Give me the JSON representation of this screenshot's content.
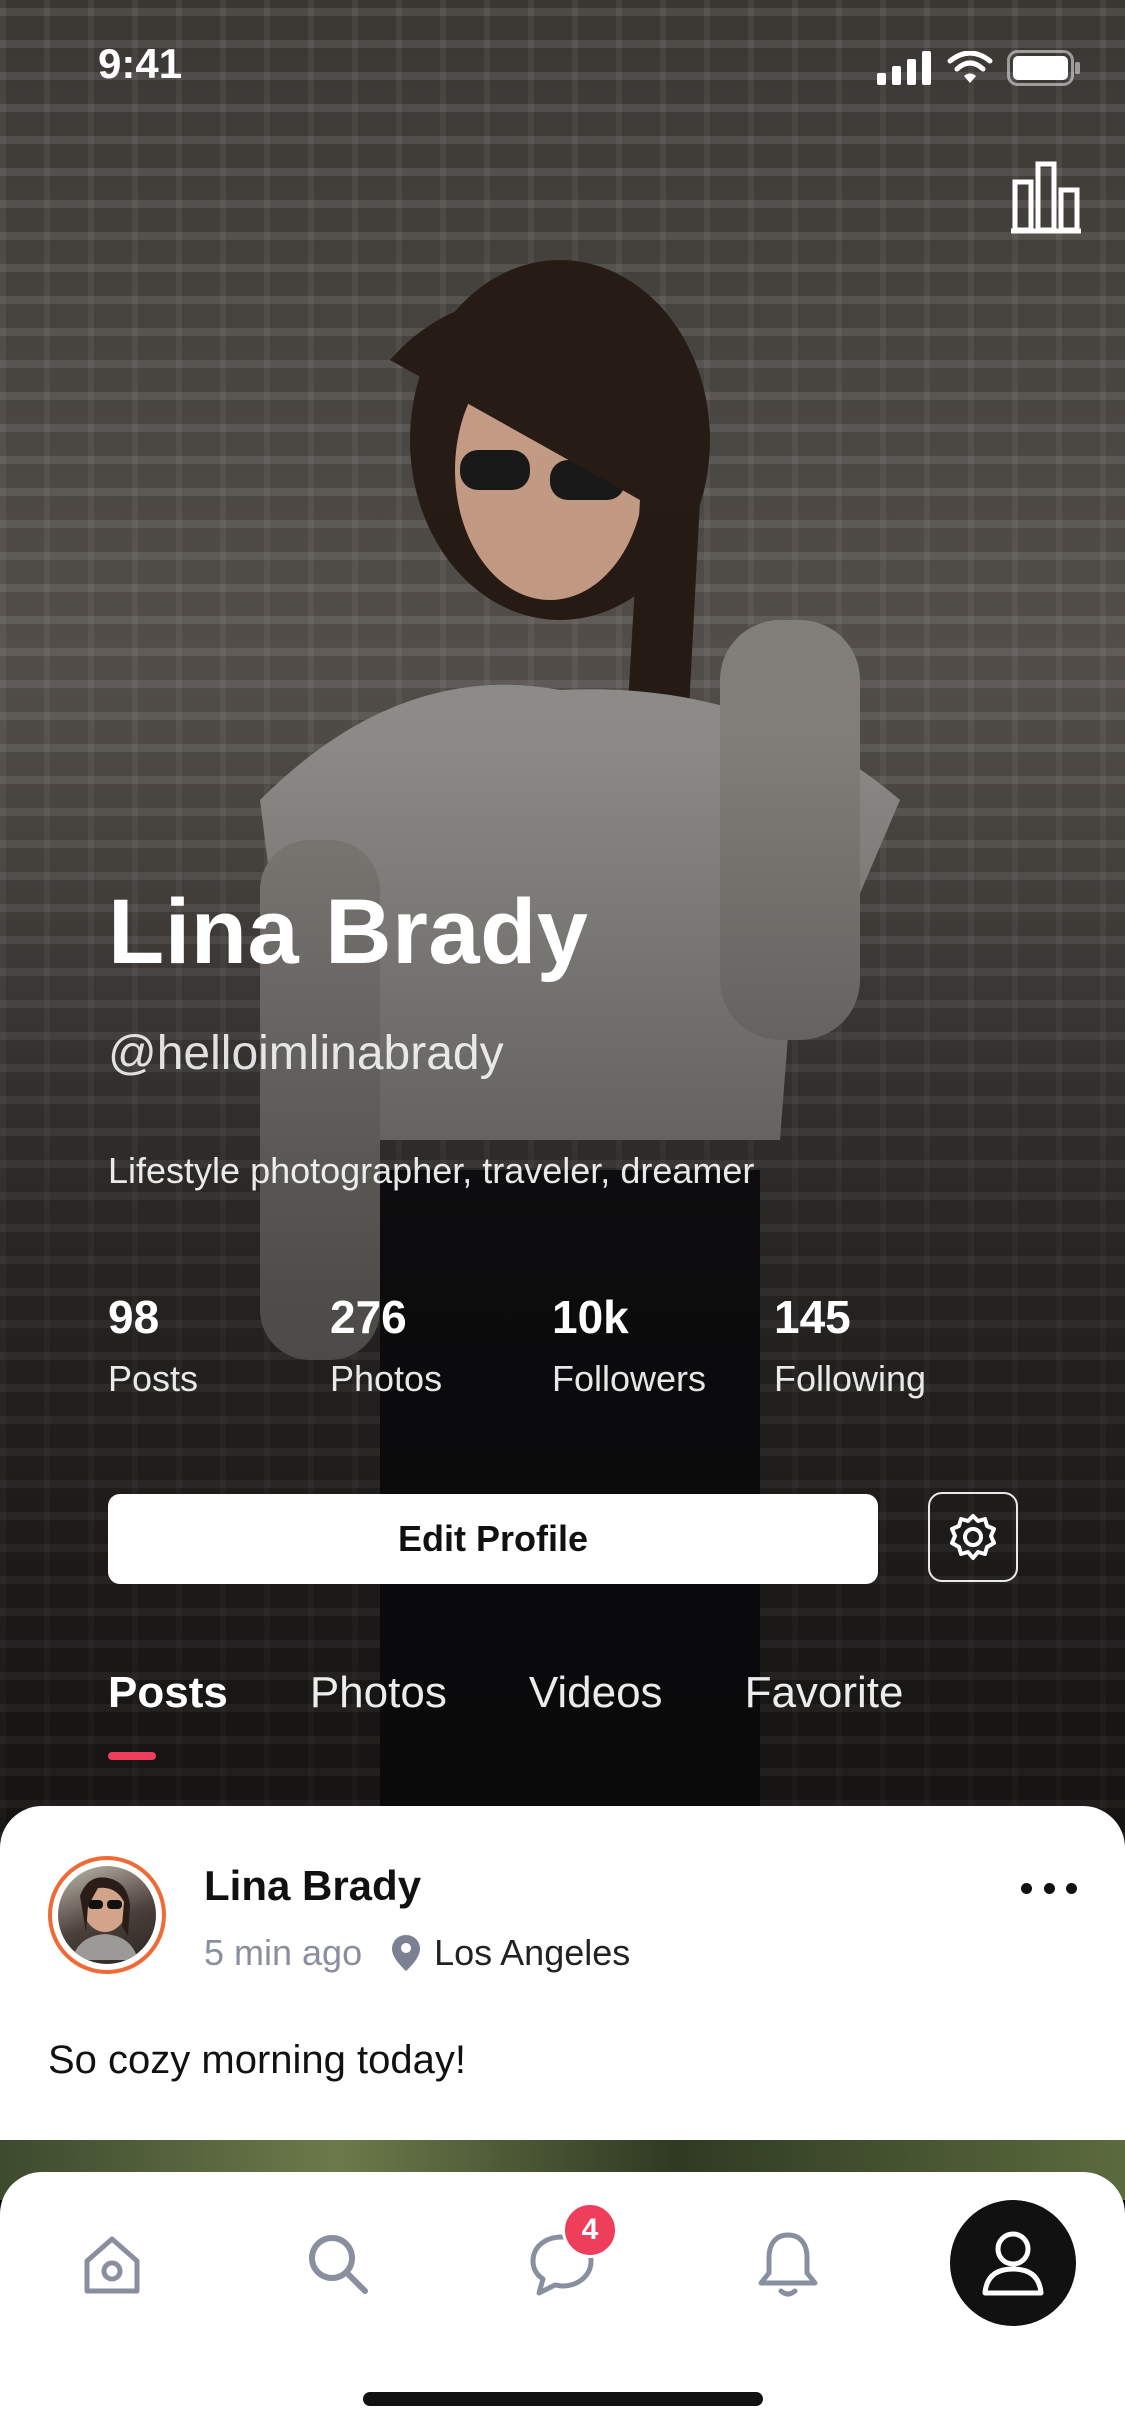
{
  "status_bar": {
    "time": "9:41"
  },
  "profile": {
    "name": "Lina Brady",
    "handle": "@helloimlinabrady",
    "bio": "Lifestyle photographer, traveler, dreamer",
    "stats": [
      {
        "value": "98",
        "label": "Posts"
      },
      {
        "value": "276",
        "label": "Photos"
      },
      {
        "value": "10k",
        "label": "Followers"
      },
      {
        "value": "145",
        "label": "Following"
      }
    ],
    "edit_button": "Edit Profile"
  },
  "tabs": [
    {
      "label": "Posts",
      "active": true
    },
    {
      "label": "Photos",
      "active": false
    },
    {
      "label": "Videos",
      "active": false
    },
    {
      "label": "Favorite",
      "active": false
    }
  ],
  "post": {
    "author": "Lina Brady",
    "time": "5 min ago",
    "location": "Los Angeles",
    "text": "So cozy morning today!"
  },
  "bottom_nav": {
    "items": [
      "home-icon",
      "search-icon",
      "chat-icon",
      "bell-icon",
      "user-icon"
    ],
    "messages_badge": "4",
    "active": "user-icon"
  },
  "colors": {
    "accent": "#ef3e5b",
    "avatar_ring": "#f06a35",
    "nav_icon": "#8a8fa0",
    "dark": "#111111"
  }
}
